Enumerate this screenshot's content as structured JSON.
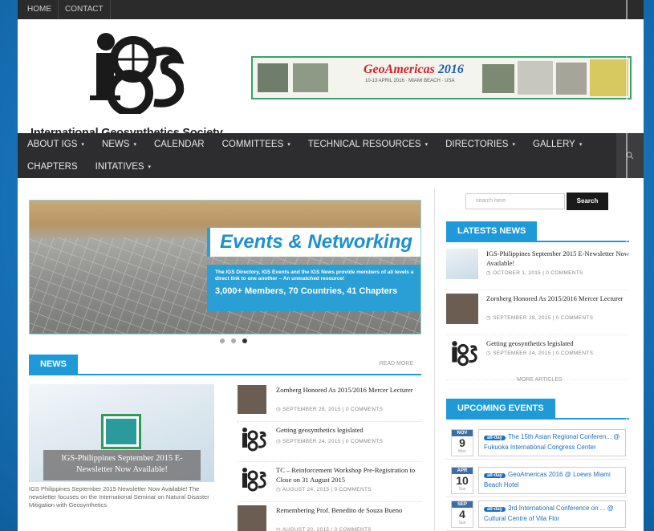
{
  "topbar": {
    "links": [
      "HOME",
      "CONTACT"
    ]
  },
  "header": {
    "logo_text": "International Geosynthetics Society",
    "banner": {
      "title_a": "GeoAmericas",
      "title_b": "2016",
      "sub": "10-13 APRIL 2016 · MIAMI BEACH · USA"
    }
  },
  "nav": {
    "row1": [
      {
        "label": "ABOUT IGS",
        "caret": true
      },
      {
        "label": "NEWS",
        "caret": true
      },
      {
        "label": "CALENDAR",
        "caret": false
      },
      {
        "label": "COMMITTEES",
        "caret": true
      },
      {
        "label": "TECHNICAL RESOURCES",
        "caret": true
      },
      {
        "label": "DIRECTORIES",
        "caret": true
      },
      {
        "label": "GALLERY",
        "caret": true
      }
    ],
    "row2": [
      {
        "label": "CHAPTERS",
        "caret": false
      },
      {
        "label": "INITATIVES",
        "caret": true
      }
    ]
  },
  "slider": {
    "title": "Events & Networking",
    "desc": "The IGS Directory, IGS Events and the IGS News provide members of all levels a direct link to one another – An unmatched resource!",
    "stats": "3,000+ Members, 70 Countries, 41 Chapters"
  },
  "news": {
    "heading": "NEWS",
    "read_more": "READ MORE",
    "featured_caption": "IGS-Philippines September 2015 E-Newsletter Now Available!",
    "featured_text": "IGS Philippines September 2015 Newsletter Now Available! The newsletter focuses on the International Seminar on Natural Disaster Mitigation with Geosynthetics",
    "items": [
      {
        "title": "Zornberg Honored As 2015/2016 Mercer Lecturer",
        "meta": "SEPTEMBER 28, 2015  |  0 COMMENTS"
      },
      {
        "title": "Getting geosynthetics legislated",
        "meta": "SEPTEMBER 24, 2015  |  0 COMMENTS"
      },
      {
        "title": "TC – Reinforcement Workshop Pre-Registration to Close on 31 August 2015",
        "meta": "AUGUST 24, 2015  |  0 COMMENTS"
      },
      {
        "title": "Remembering Prof. Benedito de Souza Bueno",
        "meta": "AUGUST 20, 2015  |  0 COMMENTS"
      }
    ]
  },
  "sidebar": {
    "search_placeholder": "search here",
    "search_button": "Search",
    "latest_heading": "LATESTS NEWS",
    "latest": [
      {
        "title": "IGS-Philippines September 2015 E-Newsletter Now Available!",
        "meta": "OCTOBER 1, 2015  |  0 COMMENTS"
      },
      {
        "title": "Zornberg Honored As 2015/2016 Mercer Lecturer",
        "meta": "SEPTEMBER 28, 2015  |  0 COMMENTS"
      },
      {
        "title": "Getting geosynthetics legislated",
        "meta": "SEPTEMBER 24, 2015  |  0 COMMENTS"
      }
    ],
    "more_articles": "MORE ARTICLES",
    "events_heading": "UPCOMING EVENTS",
    "events": [
      {
        "month": "NOV",
        "day": "9",
        "weekday": "Mon",
        "tag": "all-day",
        "text": "The 15th Asian Regional Conferen... @ Fukuoka International Congress Center"
      },
      {
        "month": "APR",
        "day": "10",
        "weekday": "Sun",
        "tag": "all-day",
        "text": "GeoAmericas 2016 @ Loews Miami Beach Hotel"
      },
      {
        "month": "SEP",
        "day": "4",
        "weekday": "Sun",
        "tag": "all-day",
        "text": "3rd International Conference on ... @ Cultural Centre of Vila Flor"
      }
    ]
  }
}
